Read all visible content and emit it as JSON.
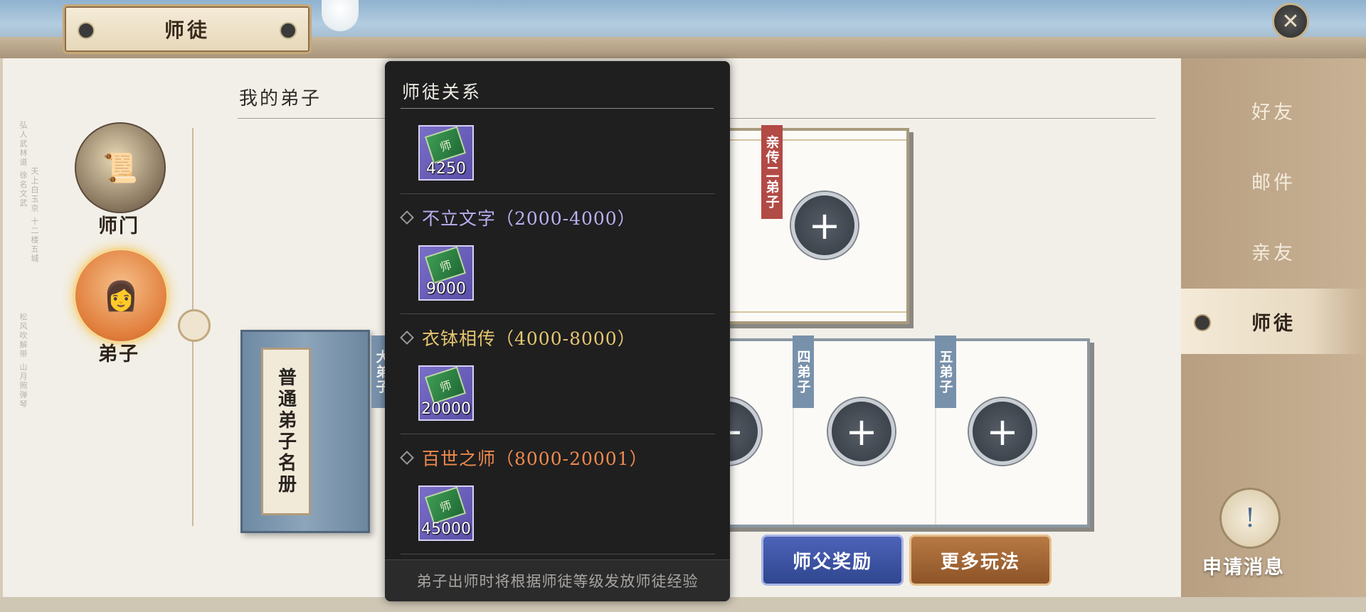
{
  "window": {
    "title": "师徒",
    "close_label": "✕"
  },
  "section": {
    "title": "我的弟子"
  },
  "left_nav": [
    {
      "label": "师门"
    },
    {
      "label": "弟子"
    }
  ],
  "roster": {
    "label": "普通弟子名册"
  },
  "slots": {
    "second": {
      "tag": "亲传二弟子"
    },
    "fourth": {
      "tag": "四弟子"
    },
    "fifth": {
      "tag": "五弟子"
    },
    "hidden_partial": {
      "tag": "大弟子"
    },
    "add_symbol": "+"
  },
  "buttons": {
    "reward": "师父奖励",
    "more": "更多玩法"
  },
  "right_menu": [
    {
      "label": "好友",
      "active": false
    },
    {
      "label": "邮件",
      "active": false
    },
    {
      "label": "亲友",
      "active": false
    },
    {
      "label": "师徒",
      "active": true
    }
  ],
  "apply": {
    "label": "申请消息"
  },
  "popup": {
    "title": "师徒关系",
    "items": [
      {
        "value": "4250",
        "icon_glyph": "师"
      },
      {
        "value": "9000",
        "icon_glyph": "师"
      },
      {
        "value": "20000",
        "icon_glyph": "师"
      },
      {
        "value": "45000",
        "icon_glyph": "师"
      }
    ],
    "tiers": [
      {
        "label": "不立文字（2000-4000）",
        "color": "#b9b0f2"
      },
      {
        "label": "衣钵相传（4000-8000）",
        "color": "#e6c66e"
      },
      {
        "label": "百世之师（8000-20001）",
        "color": "#ef8a4c"
      }
    ],
    "footer": "弟子出师时将根据师徒等级发放师徒经验"
  },
  "colors": {
    "popup_bg": "#1f1f20",
    "right_panel": "#c8b194",
    "reward_button": "#3a52a3",
    "more_button": "#a16637"
  }
}
